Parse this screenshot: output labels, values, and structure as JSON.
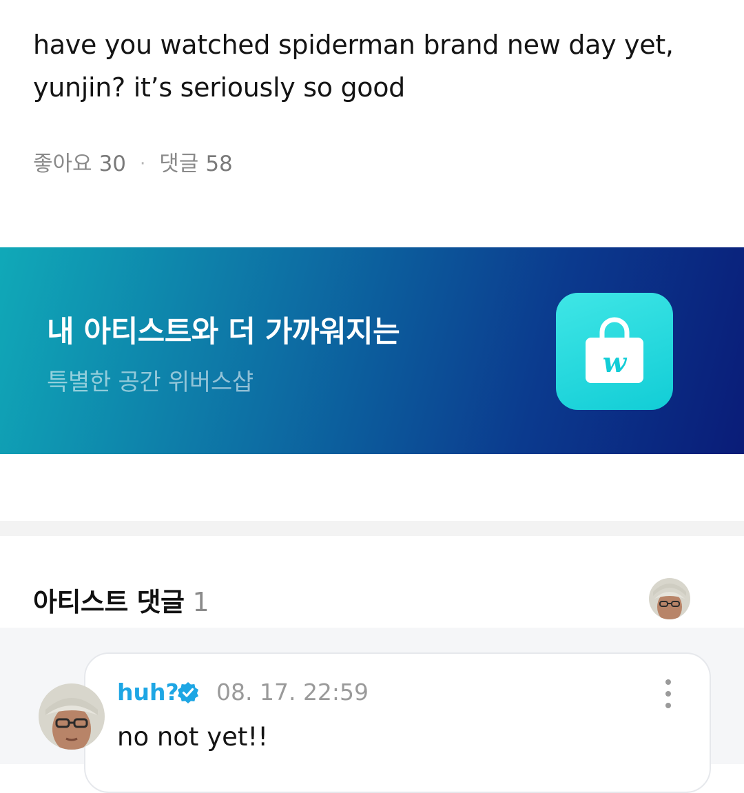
{
  "post": {
    "text_line1": "have you watched spiderman brand new day yet,",
    "text_line2": "yunjin? it’s seriously so good",
    "likes_label": "좋아요",
    "likes_count": "30",
    "separator": "·",
    "comments_label": "댓글",
    "comments_count": "58"
  },
  "banner": {
    "title": "내 아티스트와 더 가까워지는",
    "subtitle": "특별한 공간 위버스샵",
    "icon": "weverse-shop-bag-icon",
    "icon_letter": "w",
    "colors": {
      "start": "#10a9b8",
      "end": "#0a1c78",
      "icon_bg": "#12cdd6"
    }
  },
  "artist_comments": {
    "title": "아티스트 댓글",
    "count": "1",
    "comments": [
      {
        "author": "huh?",
        "verified": true,
        "timestamp": "08. 17. 22:59",
        "text": "no not yet!!"
      }
    ]
  },
  "colors": {
    "author": "#1ea6e4",
    "muted": "#8a8a8a",
    "verified": "#1ea6e4"
  }
}
